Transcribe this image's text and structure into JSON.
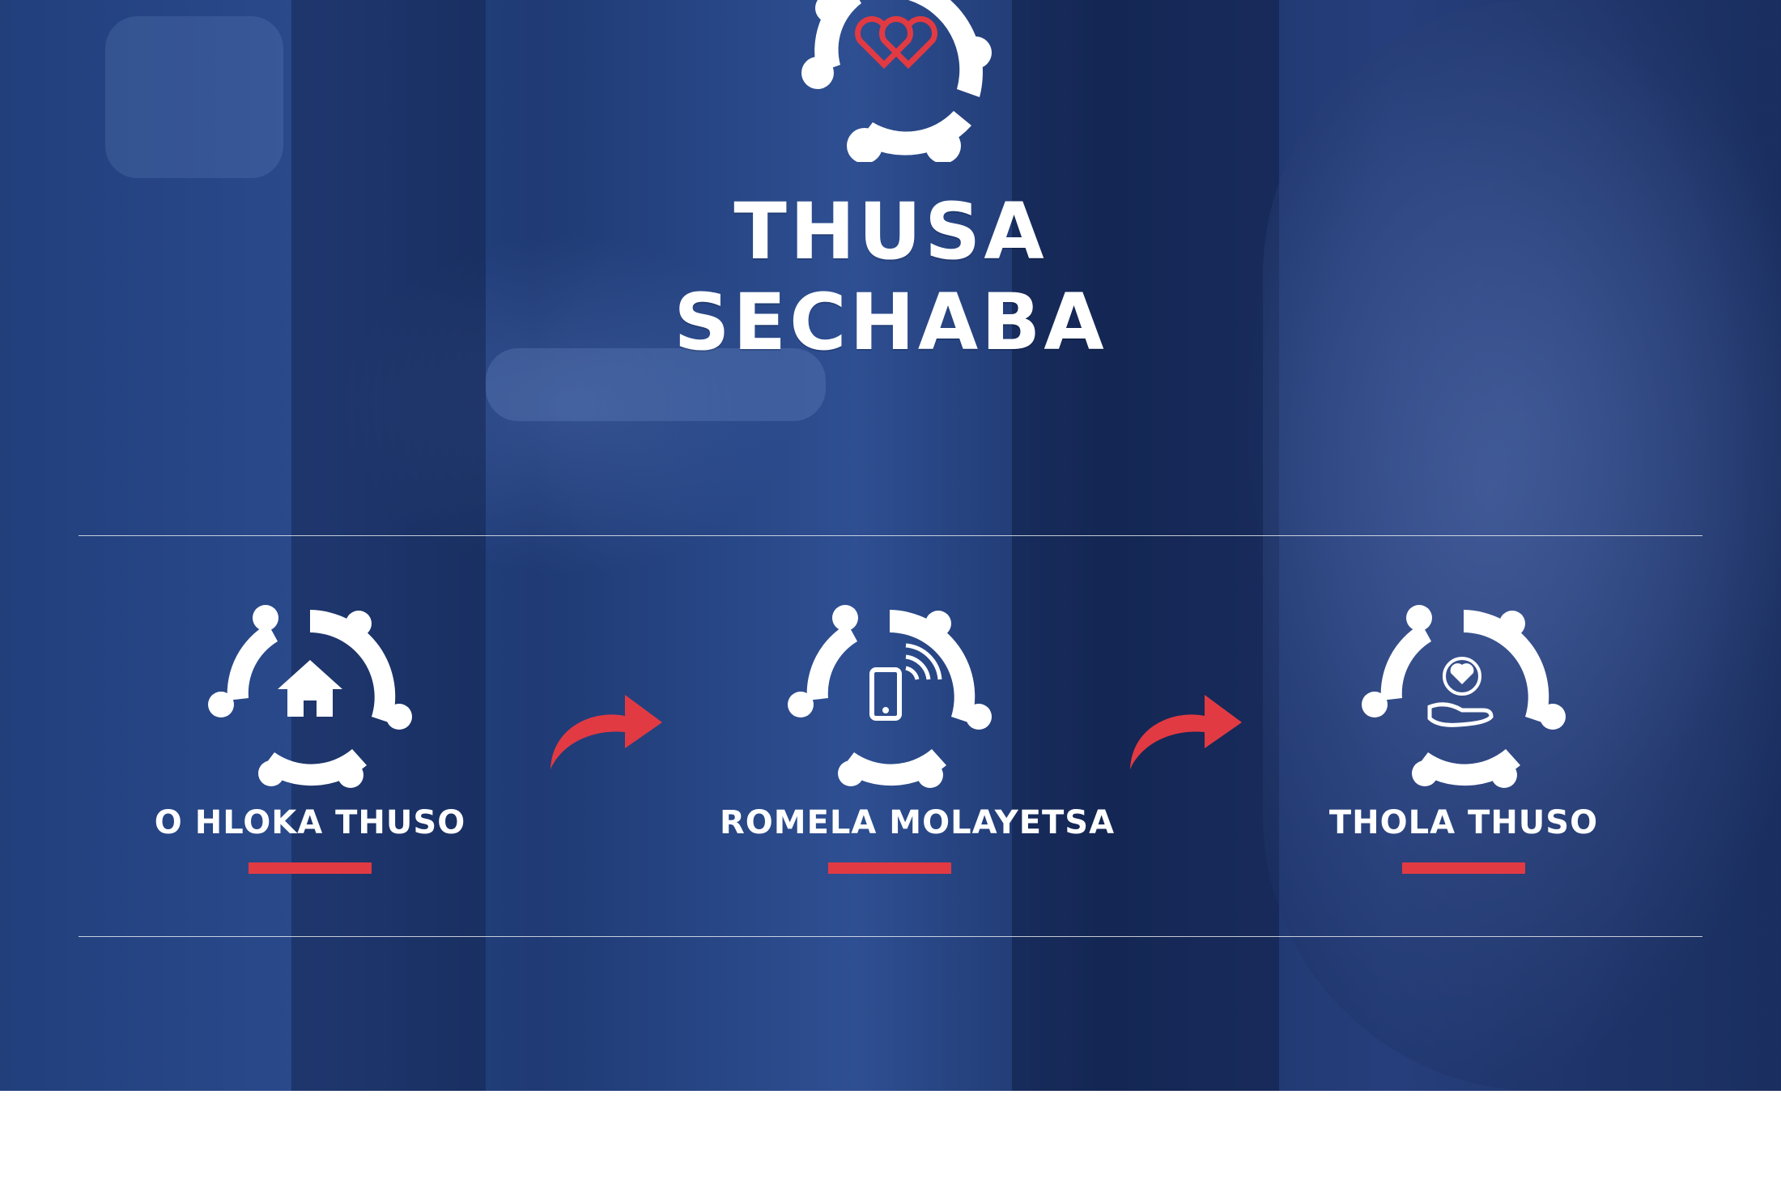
{
  "brand": {
    "title": "THUSA SECHABA",
    "logo_icon": "heart-gear-logo-icon"
  },
  "steps": [
    {
      "label": "O HLOKA THUSO",
      "icon": "house-icon"
    },
    {
      "label": "ROMELA MOLAYETSA",
      "icon": "mobile-signal-icon"
    },
    {
      "label": "THOLA THUSO",
      "icon": "heart-in-hand-icon"
    }
  ],
  "connectors": [
    {
      "icon": "curved-arrow-right-icon"
    },
    {
      "icon": "curved-arrow-right-icon"
    }
  ],
  "colors": {
    "background_blue": "#223f7c",
    "accent_red": "#e23a43",
    "text_white": "#ffffff"
  }
}
